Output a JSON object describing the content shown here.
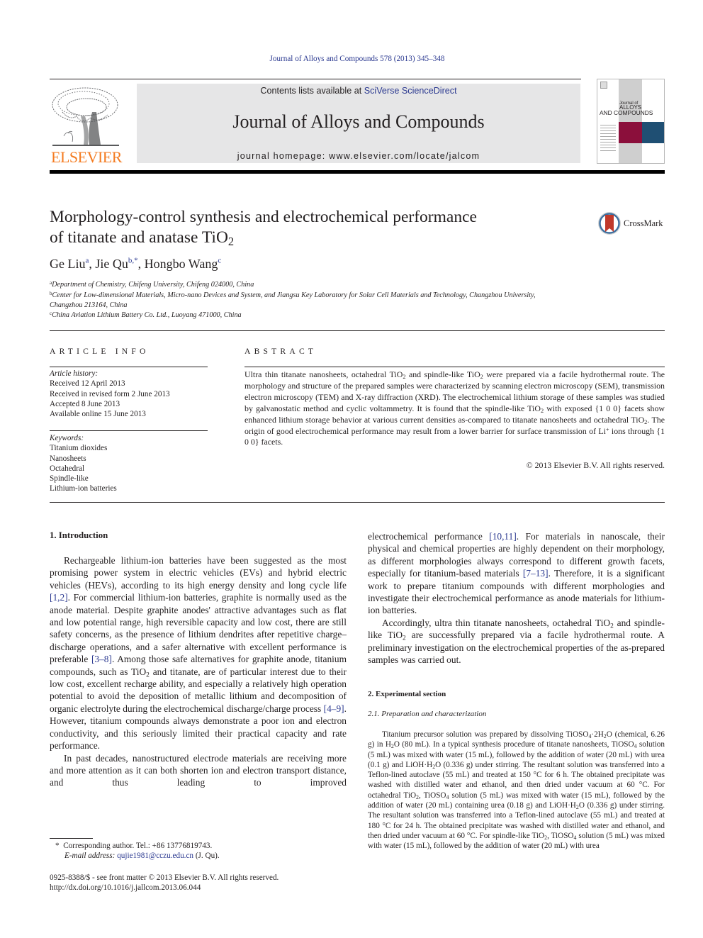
{
  "header": {
    "citation": "Journal of Alloys and Compounds 578 (2013) 345–348",
    "contents_prefix": "Contents lists available at ",
    "contents_link": "SciVerse ScienceDirect",
    "journal_title": "Journal of Alloys and Compounds",
    "homepage_prefix": "journal homepage: ",
    "homepage_url": "www.elsevier.com/locate/jalcom",
    "publisher_logo_text": "ELSEVIER",
    "cover": {
      "line1": "Journal of",
      "line2": "ALLOYS",
      "line3": "AND COMPOUNDS"
    },
    "colors": {
      "link": "#2b3990",
      "elsevier_orange": "#f47b20",
      "masthead_gray": "#e6e6e7",
      "cover_crimson": "#8b0f3b",
      "cover_blue": "#1f4f73"
    }
  },
  "article": {
    "title_line1": "Morphology-control synthesis and electrochemical performance",
    "title_line2_prefix": "of titanate and anatase TiO",
    "title_line2_sub": "2",
    "crossmark_label": "CrossMark",
    "authors": [
      {
        "name": "Ge Liu",
        "sup": "a",
        "sep": ", "
      },
      {
        "name": "Jie Qu",
        "sup": "b,*",
        "sep": ", "
      },
      {
        "name": "Hongbo Wang",
        "sup": "c",
        "sep": ""
      }
    ],
    "affiliations": [
      {
        "mark": "a",
        "text": "Department of Chemistry, Chifeng University, Chifeng 024000, China"
      },
      {
        "mark": "b",
        "text": "Center for Low-dimensional Materials, Micro-nano Devices and System, and Jiangsu Key Laboratory for Solar Cell Materials and Technology, Changzhou University,",
        "text2": "Changzhou 213164, China"
      },
      {
        "mark": "c",
        "text": "China Aviation Lithium Battery Co. Ltd., Luoyang 471000, China"
      }
    ]
  },
  "article_info": {
    "heading": "ARTICLE INFO",
    "history_label": "Article history:",
    "history": [
      "Received 12 April 2013",
      "Received in revised form 2 June 2013",
      "Accepted 8 June 2013",
      "Available online 15 June 2013"
    ],
    "keywords_label": "Keywords:",
    "keywords": [
      "Titanium dioxides",
      "Nanosheets",
      "Octahedral",
      "Spindle-like",
      "Lithium-ion batteries"
    ]
  },
  "abstract": {
    "heading": "ABSTRACT",
    "p1": "Ultra thin titanate nanosheets, octahedral TiO",
    "p2": " and spindle-like TiO",
    "p3": " were prepared via a facile hydrothermal route. The morphology and structure of the prepared samples were characterized by scanning electron microscopy (SEM), transmission electron microscopy (TEM) and X-ray diffraction (XRD). The electrochemical lithium storage of these samples was studied by galvanostatic method and cyclic voltammetry. It is found that the spindle-like TiO",
    "p4": " with exposed {1 0 0} facets show enhanced lithium storage behavior at various current densities as-compared to titanate nanosheets and octahedral TiO",
    "p5": ". The origin of good electrochemical performance may result from a lower barrier for surface transmission of Li",
    "p5_sup": "+",
    "p6": " ions through {1 0 0} facets.",
    "sub2": "2",
    "copyright": "© 2013 Elsevier B.V. All rights reserved."
  },
  "intro": {
    "heading": "1. Introduction",
    "para1_a": "Rechargeable lithium-ion batteries have been suggested as the most promising power system in electric vehicles (EVs) and hybrid electric vehicles (HEVs), according to its high energy density and long cycle life ",
    "ref1": "[1,2]",
    "para1_b": ". For commercial lithium-ion batteries, graphite is normally used as the anode material. Despite graphite anodes' attractive advantages such as flat and low potential range, high reversible capacity and low cost, there are still safety concerns, as the presence of lithium dendrites after repetitive charge–discharge operations, and a safer alternative with excellent performance is preferable ",
    "ref2": "[3–8]",
    "para1_c": ". Among those safe alternatives for graphite anode, titanium compounds, such as TiO",
    "para1_d": " and titanate, are of particular interest due to their low cost, excellent recharge ability, and especially a relatively high operation potential to avoid the deposition of metallic lithium and decomposition of organic electrolyte during the electrochemical discharge/charge process ",
    "ref3": "[4–9]",
    "para1_e": ". However, titanium compounds always demonstrate a poor ion and electron conductivity, and this seriously limited their practical capacity and rate performance.",
    "para2_a": "In past decades, nanostructured electrode materials are receiving more and more attention as it can both shorten ion and electron transport distance, and thus leading to improved",
    "para2_b": "electrochemical performance ",
    "ref4": "[10,11]",
    "para2_c": ". For materials in nanoscale, their physical and chemical properties are highly dependent on their morphology, as different morphologies always correspond to different growth facets, especially for titanium-based materials ",
    "ref5": "[7–13]",
    "para2_d": ". Therefore, it is a significant work to prepare titanium compounds with different morphologies and investigate their electrochemical performance as anode materials for lithium-ion batteries.",
    "para3_a": "Accordingly, ultra thin titanate nanosheets, octahedral TiO",
    "para3_b": " and spindle-like TiO",
    "para3_c": " are successfully prepared via a facile hydrothermal route. A preliminary investigation on the electrochemical properties of the as-prepared samples was carried out.",
    "sub2": "2"
  },
  "experimental": {
    "heading": "2. Experimental section",
    "subheading": "2.1. Preparation and characterization",
    "text_a": "Titanium precursor solution was prepared by dissolving TiOSO",
    "text_b": "·2H",
    "text_c": "O (chemical, 6.26 g) in H",
    "text_d": "O (80 mL). In a typical synthesis procedure of titanate nanosheets, TiOSO",
    "text_e": " solution (5 mL) was mixed with water (15 mL), followed by the addition of water (20 mL) with urea (0.1 g) and LiOH·H",
    "text_f": "O (0.336 g) under stirring. The resultant solution was transferred into a Teflon-lined autoclave (55 mL) and treated at 150 °C for 6 h. The obtained precipitate was washed with distilled water and ethanol, and then dried under vacuum at 60 °C. For octahedral TiO",
    "text_g": ", TiOSO",
    "text_h": " solution (5 mL) was mixed with water (15 mL), followed by the addition of water (20 mL) containing urea (0.18 g) and LiOH·H",
    "text_i": "O (0.336 g) under stirring. The resultant solution was transferred into a Teflon-lined autoclave (55 mL) and treated at 180 °C for 24 h. The obtained precipitate was washed with distilled water and ethanol, and then dried under vacuum at 60 °C. For spindle-like TiO",
    "text_j": ", TiOSO",
    "text_k": " solution (5 mL) was mixed with water (15 mL), followed by the addition of water (20 mL) with urea",
    "sub2": "2",
    "sub4": "4"
  },
  "footer": {
    "corresponding": "Corresponding author. Tel.: +86 13776819743.",
    "asterisk": "*",
    "email_label": "E-mail address: ",
    "email": "qujie1981@cczu.edu.cn",
    "email_suffix": " (J. Qu).",
    "issn": "0925-8388/$ - see front matter © 2013 Elsevier B.V. All rights reserved.",
    "doi": "http://dx.doi.org/10.1016/j.jallcom.2013.06.044"
  }
}
